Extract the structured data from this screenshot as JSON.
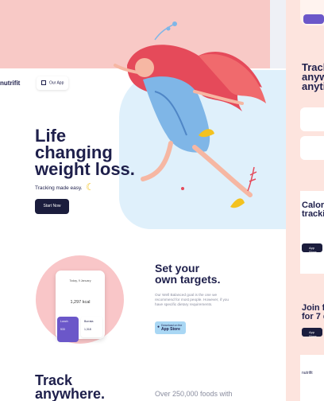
{
  "colors": {
    "navy": "#1e1f4b",
    "pink": "#f8c9c6",
    "purple": "#6b57c9",
    "blue": "#a9d7f4"
  },
  "header": {
    "logo": "nutrifit",
    "our_app": "Our App",
    "grid_icon": "grid-icon"
  },
  "hero": {
    "headline_lines": [
      "Life",
      "changing",
      "weight loss."
    ],
    "subtitle": "Tracking made easy.",
    "cta": "Start Now"
  },
  "phone": {
    "date": "Today, 9 January",
    "kcal": "1,297 kcal",
    "card_left_title": "Lunch",
    "card_left_value": "533",
    "card_right_title": "Burrata",
    "card_right_value": "1,318"
  },
  "targets": {
    "heading_lines": [
      "Set your",
      "own targets."
    ],
    "body": "Our Well Balanced goal is the one we recommend for most people. However, if you have specific dietary requirements.",
    "store_small": "Download on the",
    "store_big": "App Store"
  },
  "track": {
    "heading_lines": [
      "Track",
      "anywhere."
    ],
    "foods": "Over 250,000 foods with"
  },
  "right_panel": {
    "track_lines": [
      "Track",
      "anyw",
      "anyti"
    ],
    "calorie_lines": [
      "Calori",
      "trackin"
    ],
    "join_lines": [
      "Join fr",
      "for 7 d"
    ],
    "store_label": "App Store"
  }
}
